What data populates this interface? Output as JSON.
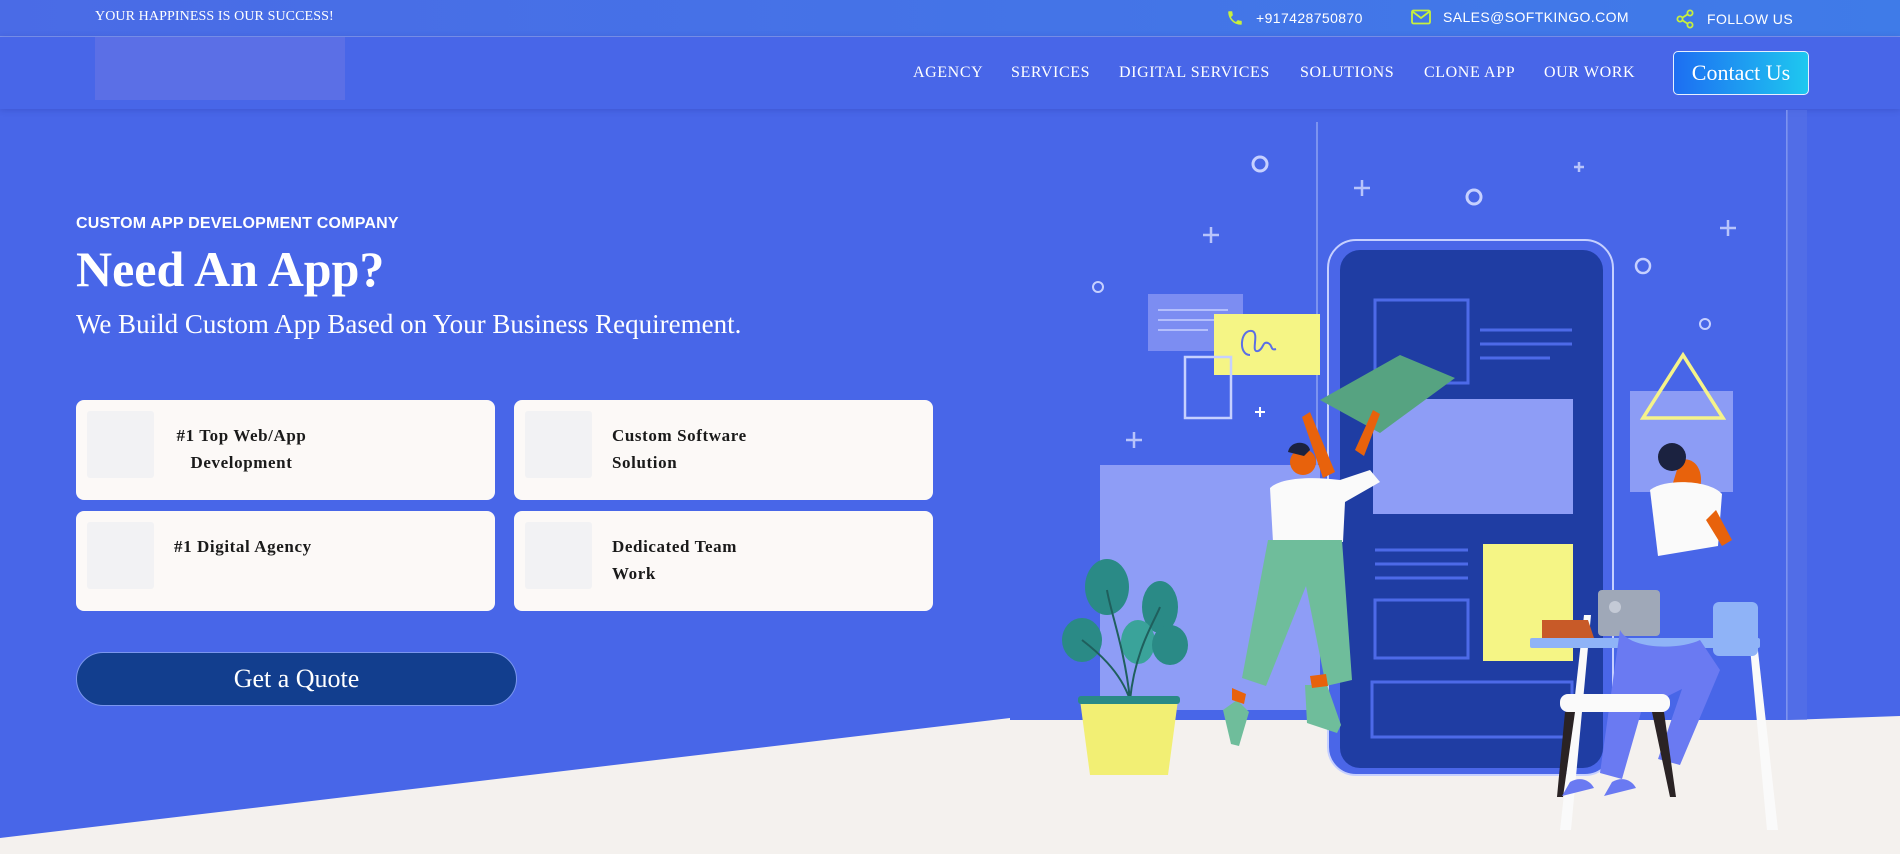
{
  "topbar": {
    "tagline": "YOUR HAPPINESS IS OUR SUCCESS!",
    "phone": "+917428750870",
    "email": "SALES@SOFTKINGO.COM",
    "follow": "FOLLOW US",
    "icon_color": "#c8f03c"
  },
  "nav": {
    "links": [
      "AGENCY",
      "SERVICES",
      "DIGITAL SERVICES",
      "SOLUTIONS",
      "CLONE APP",
      "OUR WORK"
    ],
    "contact": "Contact Us"
  },
  "hero": {
    "eyebrow": "CUSTOM APP DEVELOPMENT COMPANY",
    "headline": "Need An App?",
    "subhead": "We Build Custom App Based on Your Business Requirement.",
    "features": [
      {
        "line1": "#1 Top Web/App",
        "line2": "Development"
      },
      {
        "line1": "Custom Software",
        "line2": "Solution"
      },
      {
        "line1": "#1 Digital Agency",
        "line2": ""
      },
      {
        "line1": "Dedicated Team",
        "line2": "Work"
      }
    ],
    "cta": "Get a Quote"
  },
  "colors": {
    "background": "#4866e8",
    "cta": "#123e8e",
    "floor": "#f4f1ee"
  }
}
